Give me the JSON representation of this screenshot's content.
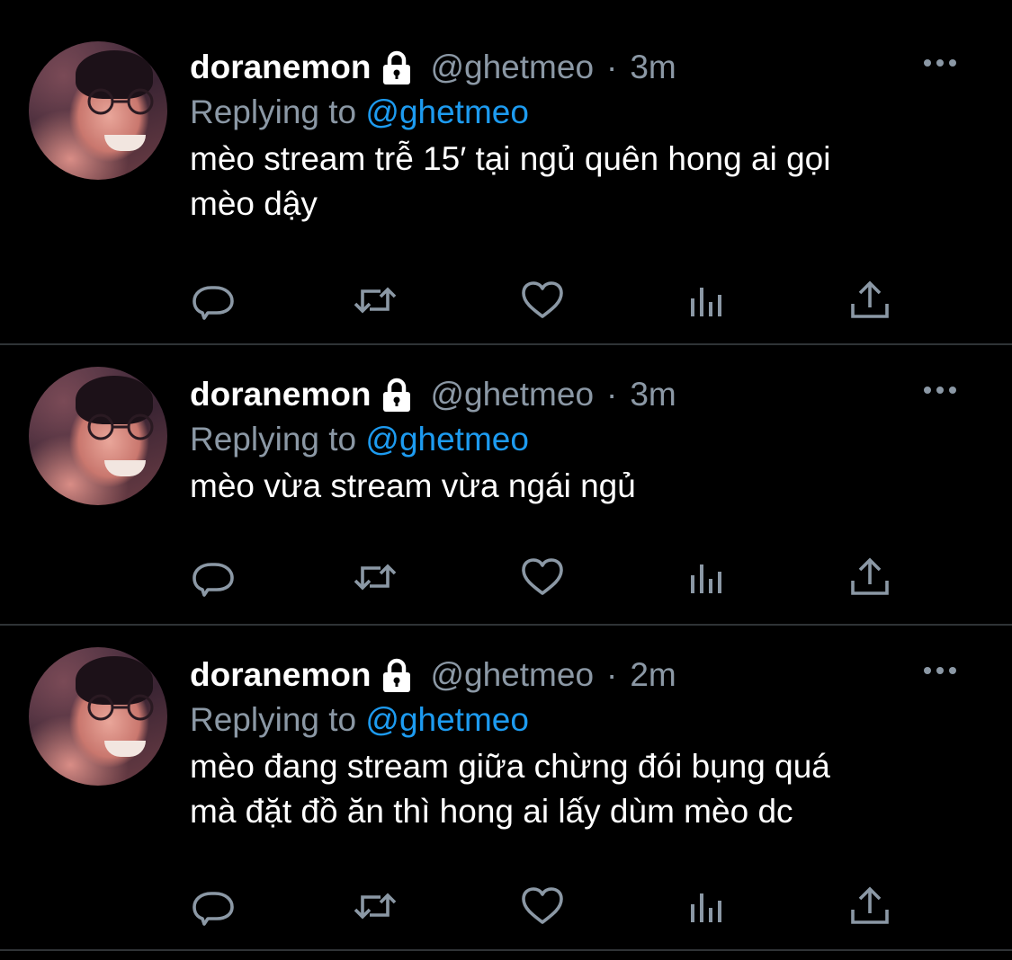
{
  "tweets": [
    {
      "name": "doranemon",
      "handle": "@ghetmeo",
      "separator": "·",
      "time": "3m",
      "replying_prefix": "Replying to",
      "replying_to": "@ghetmeo",
      "lines": [
        "mèo stream trễ 15′ tại ngủ quên hong ai gọi",
        "mèo dậy"
      ]
    },
    {
      "name": "doranemon",
      "handle": "@ghetmeo",
      "separator": "·",
      "time": "3m",
      "replying_prefix": "Replying to",
      "replying_to": "@ghetmeo",
      "lines": [
        "mèo vừa stream vừa ngái ngủ"
      ]
    },
    {
      "name": "doranemon",
      "handle": "@ghetmeo",
      "separator": "·",
      "time": "2m",
      "replying_prefix": "Replying to",
      "replying_to": "@ghetmeo",
      "lines": [
        "mèo đang stream giữa chừng đói bụng quá",
        "mà đặt đồ ăn thì hong ai lấy dùm mèo dc"
      ]
    }
  ],
  "icons": {
    "protected": "lock-icon",
    "more": "more-icon",
    "reply": "reply-icon",
    "retweet": "retweet-icon",
    "like": "like-icon",
    "stats": "stats-icon",
    "share": "share-icon"
  },
  "colors": {
    "background": "#000000",
    "text": "#ffffff",
    "secondary": "#8b98a5",
    "link": "#1d9bf0",
    "divider": "#2f3336"
  }
}
